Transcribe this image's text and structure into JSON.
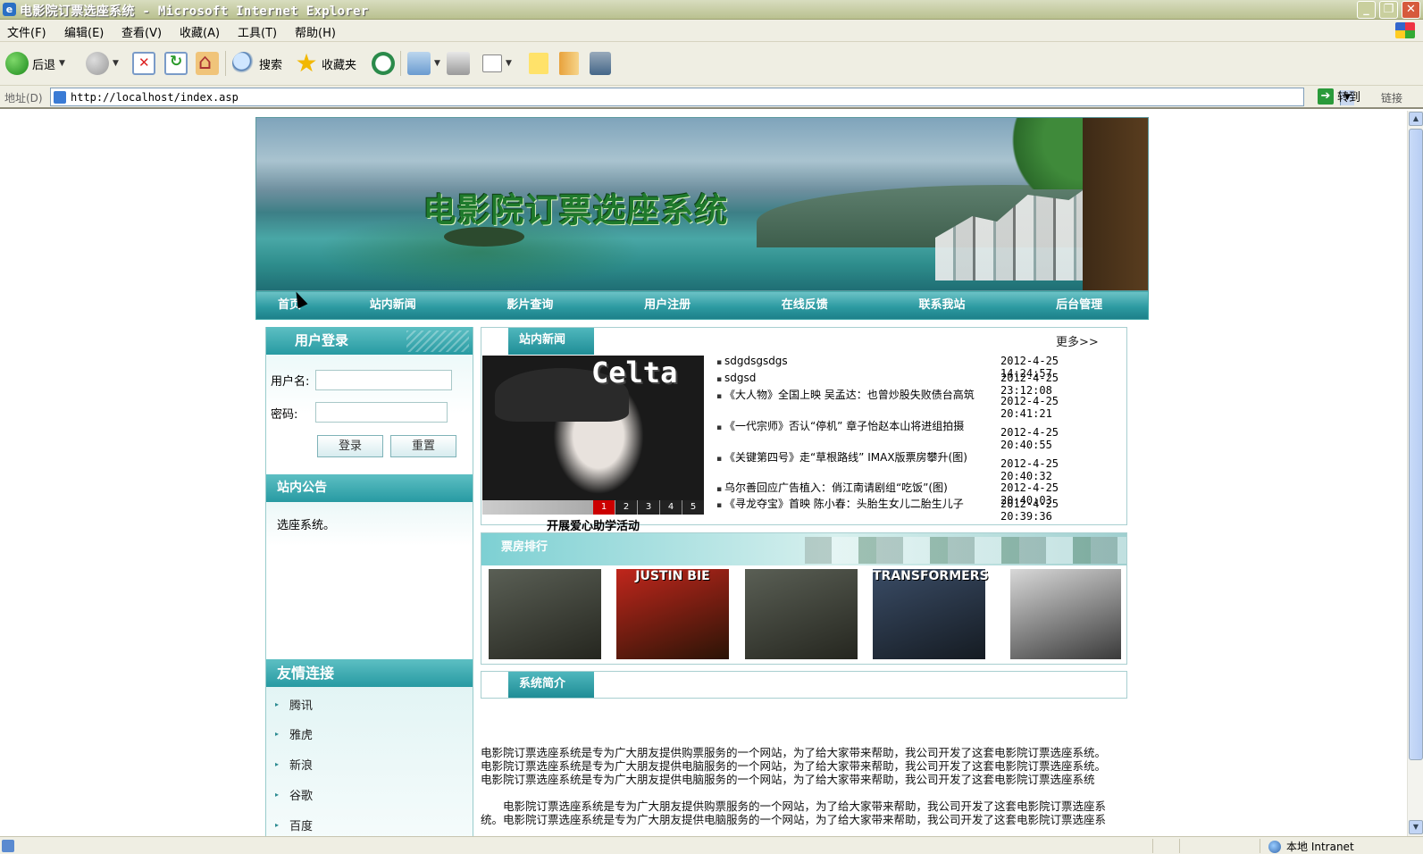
{
  "window": {
    "title": "电影院订票选座系统 - Microsoft Internet Explorer"
  },
  "menu": [
    "文件(F)",
    "编辑(E)",
    "查看(V)",
    "收藏(A)",
    "工具(T)",
    "帮助(H)"
  ],
  "toolbar": {
    "back_label": "后退",
    "search_label": "搜索",
    "favorites_label": "收藏夹"
  },
  "address": {
    "label": "地址(D)",
    "url": "http://localhost/index.asp",
    "go_label": "转到",
    "links_label": "链接"
  },
  "status": {
    "zone": "本地 Intranet"
  },
  "site": {
    "title": "电影院订票选座系统"
  },
  "nav": [
    "首页",
    "站内新闻",
    "影片查询",
    "用户注册",
    "在线反馈",
    "联系我站",
    "后台管理"
  ],
  "login": {
    "title": "用户登录",
    "username_label": "用户名:",
    "password_label": "密码:",
    "login_button": "登录",
    "reset_button": "重置"
  },
  "notice": {
    "title": "站内公告",
    "text": "选座系统。"
  },
  "friends": {
    "title": "友情连接",
    "links": [
      "腾讯",
      "雅虎",
      "新浪",
      "谷歌",
      "百度"
    ]
  },
  "news": {
    "title": "站内新闻",
    "more": "更多>>",
    "slide_brand": "Celta",
    "slide_numbers": [
      "1",
      "2",
      "3",
      "4",
      "5"
    ],
    "slide_caption": "开展爱心助学活动",
    "items": [
      {
        "title": "sdgdsgsdgs",
        "date": "2012-4-25 14:24:57"
      },
      {
        "title": "sdgsd",
        "date": "2012-4-25 23:12:08"
      },
      {
        "title": "《大人物》全国上映 吴孟达：也曾炒股失败债台高筑",
        "date": "2012-4-25 20:41:21"
      },
      {
        "title": "《一代宗师》否认“停机” 章子怡赵本山将进组拍摄",
        "date": "2012-4-25 20:40:55"
      },
      {
        "title": "《关键第四号》走“草根路线” IMAX版票房攀升(图)",
        "date": "2012-4-25 20:40:32"
      },
      {
        "title": "乌尔善回应广告植入：俏江南请剧组“吃饭”(图)",
        "date": "2012-4-25 20:40:03"
      },
      {
        "title": "《寻龙夺宝》首映 陈小春：头胎生女儿二胎生儿子",
        "date": "2012-4-25 20:39:36"
      }
    ]
  },
  "boxoffice": {
    "title": "票房排行",
    "posters": [
      {
        "label": "",
        "c1": "#5a5f55",
        "c2": "#25261f"
      },
      {
        "label": "JUSTIN BIE",
        "c1": "#c0261c",
        "c2": "#2a1406"
      },
      {
        "label": "",
        "c1": "#5a5f55",
        "c2": "#25261f"
      },
      {
        "label": "TRANSFORMERS",
        "c1": "#3a4c66",
        "c2": "#151b22"
      },
      {
        "label": "",
        "c1": "#d8d8d8",
        "c2": "#3a3a3a"
      }
    ]
  },
  "intro": {
    "title": "系统简介",
    "lines": [
      "电影院订票选座系统是专为广大朋友提供购票服务的一个网站，为了给大家带来帮助，我公司开发了这套电影院订票选座系统。",
      "电影院订票选座系统是专为广大朋友提供电脑服务的一个网站，为了给大家带来帮助，我公司开发了这套电影院订票选座系统。",
      "电影院订票选座系统是专为广大朋友提供电脑服务的一个网站，为了给大家带来帮助，我公司开发了这套电影院订票选座系统",
      "　　电影院订票选座系统是专为广大朋友提供购票服务的一个网站，为了给大家带来帮助，我公司开发了这套电影院订票选座系",
      "统。电影院订票选座系统是专为广大朋友提供电脑服务的一个网站，为了给大家带来帮助，我公司开发了这套电影院订票选座系"
    ]
  }
}
